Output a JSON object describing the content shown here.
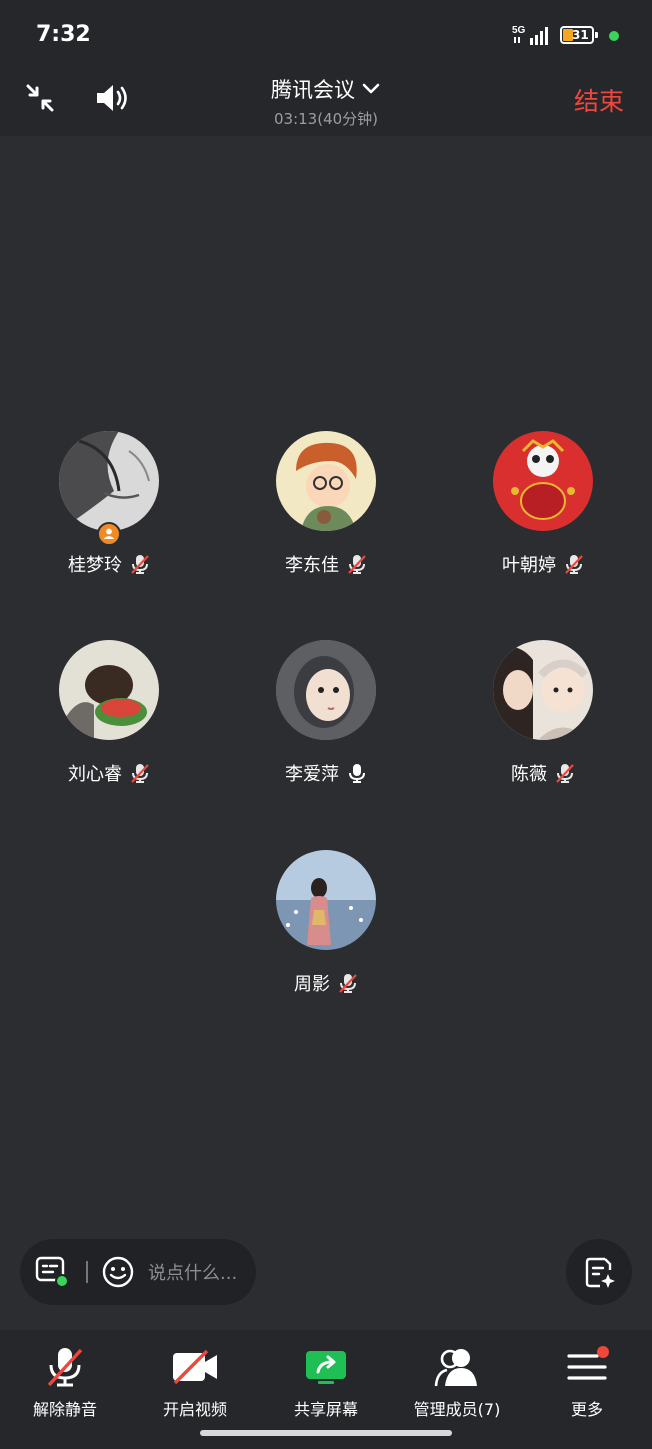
{
  "status_bar": {
    "time": "7:32",
    "network": "5G",
    "battery": "31"
  },
  "header": {
    "title": "腾讯会议",
    "subtitle": "03:13(40分钟)",
    "end_label": "结束"
  },
  "participants": [
    {
      "name": "桂梦玲",
      "muted": true,
      "host": true
    },
    {
      "name": "李东佳",
      "muted": true
    },
    {
      "name": "叶朝婷",
      "muted": true
    },
    {
      "name": "刘心睿",
      "muted": true
    },
    {
      "name": "李爱萍",
      "muted": false
    },
    {
      "name": "陈薇",
      "muted": true
    },
    {
      "name": "周影",
      "muted": true
    }
  ],
  "chat": {
    "placeholder": "说点什么..."
  },
  "toolbar": {
    "unmute": "解除静音",
    "video": "开启视频",
    "share": "共享屏幕",
    "members": "管理成员(7)",
    "more": "更多"
  },
  "colors": {
    "end": "#f0463c",
    "share_accent": "#1fbf55",
    "badge": "#f08a24"
  }
}
